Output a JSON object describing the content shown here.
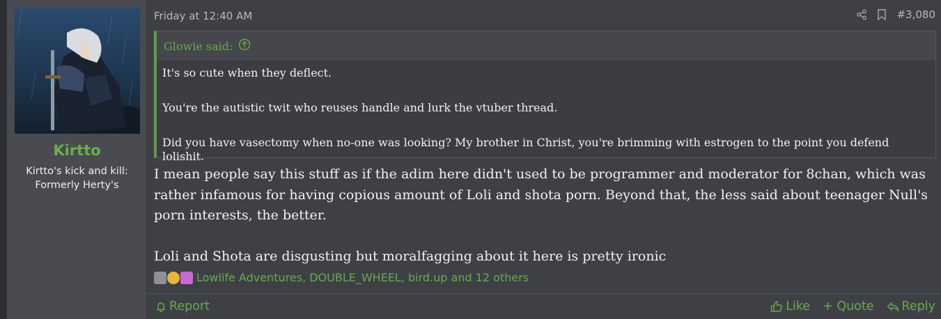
{
  "user": {
    "name": "Kirtto",
    "title_line1": "Kirtto's kick and kill:",
    "title_line2": "Formerly Herty's"
  },
  "post": {
    "date": "Friday at 12:40 AM",
    "number": "#3,080",
    "quote": {
      "author": "Glowie said:",
      "lines": [
        "It's so cute when they deflect.",
        "You're the autistic twit who reuses handle and lurk the vtuber thread.",
        "Did you have vasectomy when no-one was looking? My brother in Christ, you're brimming with estrogen to the point you defend lolishit."
      ]
    },
    "message": [
      "I mean people say this stuff as if the adim here didn't used to be programmer and moderator for 8chan, which was rather infamous for having copious amount of Loli and shota porn. Beyond that, the less said about teenager Null's porn interests, the better.",
      "Loli and Shota are disgusting but moralfagging about it here is pretty ironic"
    ],
    "reactions": {
      "text": "Lowlife Adventures, DOUBLE_WHEEL, bird.up and 12 others",
      "icons": [
        "dumpster-icon",
        "thinking-icon",
        "puzzle-icon"
      ]
    }
  },
  "footer": {
    "report": "Report",
    "like": "Like",
    "quote": "+ Quote",
    "reply": "Reply"
  },
  "colors": {
    "accent": "#6aa84f",
    "background": "#3e4046",
    "sidebar": "#494b50"
  }
}
